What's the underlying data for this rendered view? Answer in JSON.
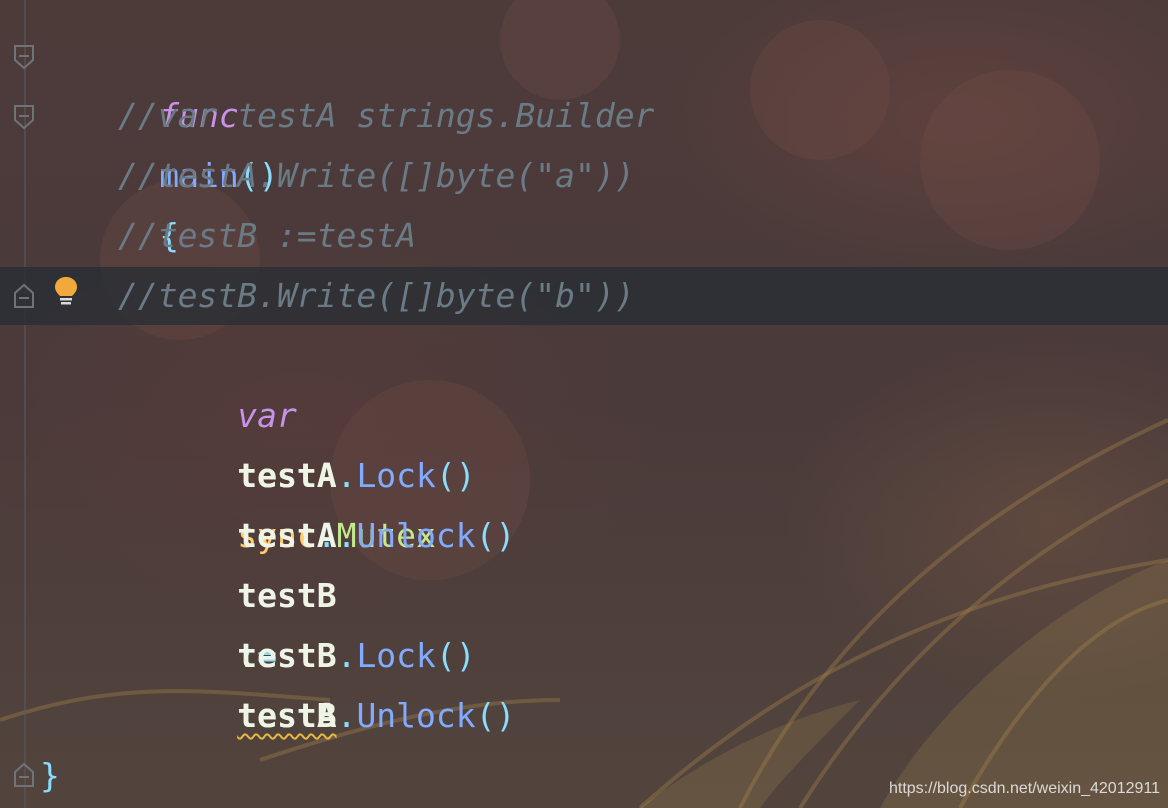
{
  "editor": {
    "language": "go",
    "lines": [
      {
        "id": "l1",
        "tokens": [
          "func",
          "main",
          "()",
          "{"
        ]
      },
      {
        "id": "l2",
        "text": "//var testA strings.Builder"
      },
      {
        "id": "l3",
        "text": "//testA.Write([]byte(\"a\"))"
      },
      {
        "id": "l4",
        "text": "//testB :=testA"
      },
      {
        "id": "l5",
        "text": "//testB.Write([]byte(\"b\"))"
      },
      {
        "id": "l6",
        "tokens": [
          "var",
          "testA",
          "sync",
          ".",
          "Mutex"
        ]
      },
      {
        "id": "l7",
        "tokens": [
          "testA",
          ".",
          "Lock",
          "()"
        ]
      },
      {
        "id": "l8",
        "tokens": [
          "testA",
          ".",
          "Unlock",
          "()"
        ]
      },
      {
        "id": "l9",
        "tokens": [
          "testB",
          ":=",
          "testA"
        ]
      },
      {
        "id": "l10",
        "tokens": [
          "testB",
          ".",
          "Lock",
          "()"
        ]
      },
      {
        "id": "l11",
        "tokens": [
          "testB",
          ".",
          "Unlock",
          "()"
        ]
      },
      {
        "id": "l12",
        "text": "}"
      }
    ],
    "current_line": 5,
    "gutter_icons": {
      "fold": "fold-marker-icon",
      "intention": "lightbulb-icon"
    }
  },
  "watermark": "https://blog.csdn.net/weixin_42012911",
  "colors": {
    "keyword": "#c792ea",
    "function": "#82aaff",
    "comment": "#6b7b86",
    "identifier": "#eef5e6",
    "package": "#ffcb6b",
    "type": "#c3e88d",
    "punctuation": "#89ddff",
    "warning_underline": "#e5b842",
    "bulb": "#f2a93b"
  }
}
